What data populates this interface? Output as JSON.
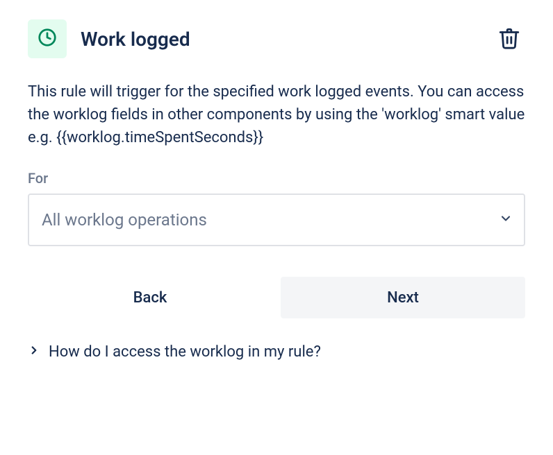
{
  "header": {
    "title": "Work logged"
  },
  "description": "This rule will trigger for the specified work logged events. You can access the worklog fields in other components by using the 'worklog' smart value e.g. {{worklog.timeSpentSeconds}}",
  "form": {
    "for_label": "For",
    "for_value": "All worklog operations"
  },
  "buttons": {
    "back": "Back",
    "next": "Next"
  },
  "expand": {
    "label": "How do I access the worklog in my rule?"
  },
  "colors": {
    "icon_badge_bg": "#e3fcef",
    "icon_stroke": "#00875a",
    "text_primary": "#172b4d",
    "text_muted": "#6b778c",
    "border": "#dfe1e6",
    "btn_next_bg": "#f4f5f7"
  }
}
